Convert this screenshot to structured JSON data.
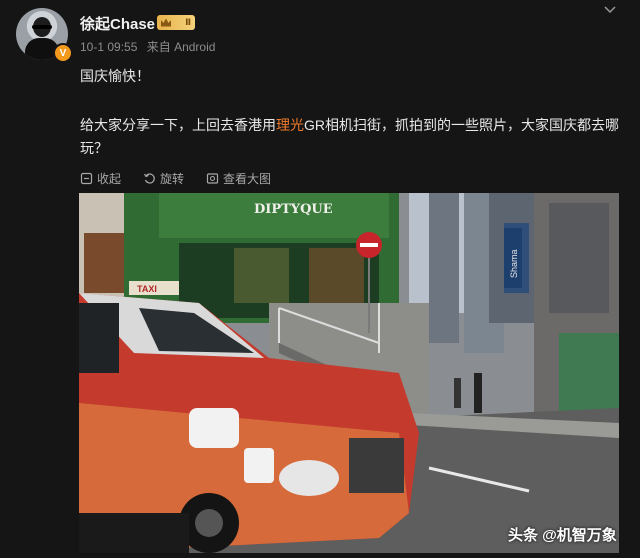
{
  "post": {
    "username": "徐起Chase",
    "level": "Ⅱ",
    "time": "10-1 09:55",
    "source": "来自 Android",
    "verified": "V",
    "line1": "国庆愉快！",
    "line2_before": "给大家分享一下，上回去香港用",
    "line2_brand": "理光",
    "line2_after": "GR相机扫街，抓拍到的一些照片，大家国庆都去哪玩？"
  },
  "actions": {
    "collect": "收起",
    "rotate": "旋转",
    "view_large": "查看大图"
  },
  "photo": {
    "shop_sign": "DIPTYQUE",
    "taxi_sign": "TAXI",
    "banner": "Shama"
  },
  "watermark": "头条 @机智万象",
  "colors": {
    "background": "#151515",
    "brand_link": "#f07a2a",
    "badge": "#f39a1d"
  },
  "icons": [
    "chevron-down-icon",
    "collapse-icon",
    "rotate-icon",
    "view-large-icon",
    "crown-icon"
  ]
}
